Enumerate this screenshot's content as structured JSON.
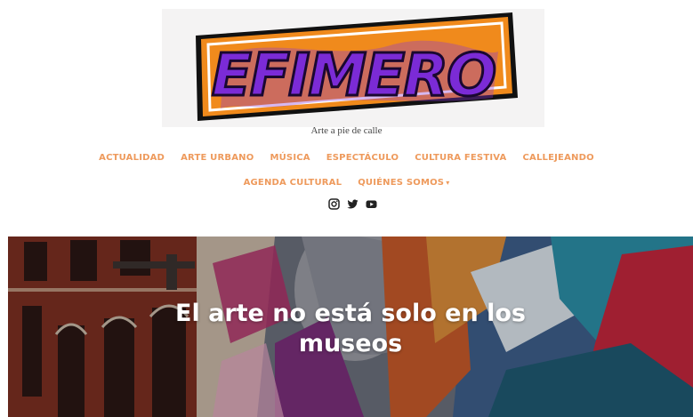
{
  "logo": {
    "text": "EFIMERO"
  },
  "tagline": "Arte a pie de calle",
  "nav": {
    "row1": [
      "ACTUALIDAD",
      "ARTE URBANO",
      "MÚSICA",
      "ESPECTÁCULO",
      "CULTURA FESTIVA",
      "CALLEJEANDO"
    ],
    "row2": [
      "AGENDA CULTURAL",
      "QUIÉNES SOMOS"
    ],
    "dropdown_caret": "▾"
  },
  "social": [
    "instagram-icon",
    "twitter-icon",
    "youtube-icon"
  ],
  "hero": {
    "title_line1": "El arte no está solo en los",
    "title_line2": "museos"
  },
  "colors": {
    "nav": "#ee9a5c",
    "logo_orange": "#f08a1c",
    "logo_purple": "#7b2bd6"
  }
}
